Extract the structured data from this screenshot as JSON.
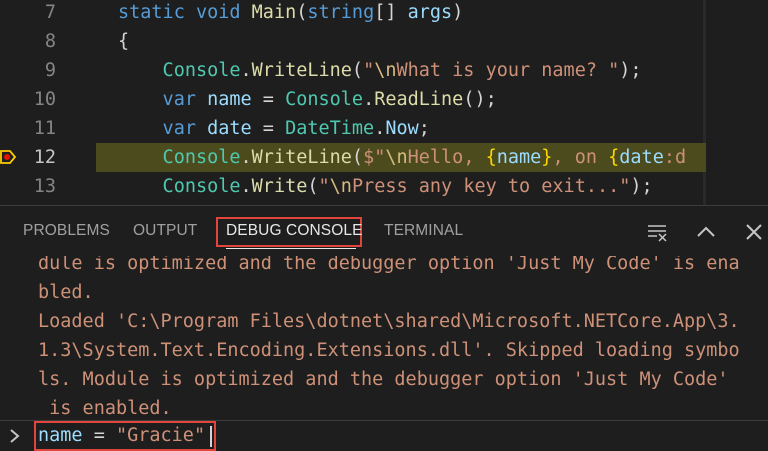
{
  "editor": {
    "lines": [
      {
        "num": "7",
        "tokens": [
          {
            "t": "static ",
            "c": "kw"
          },
          {
            "t": "void ",
            "c": "kw"
          },
          {
            "t": "Main",
            "c": "fn"
          },
          {
            "t": "(",
            "c": "punc"
          },
          {
            "t": "string",
            "c": "kw"
          },
          {
            "t": "[] ",
            "c": "punc"
          },
          {
            "t": "args",
            "c": "var"
          },
          {
            "t": ")",
            "c": "punc"
          }
        ]
      },
      {
        "num": "8",
        "tokens": [
          {
            "t": "{",
            "c": "punc"
          }
        ]
      },
      {
        "num": "9",
        "tokens": [
          {
            "t": "    Console",
            "c": "cls"
          },
          {
            "t": ".",
            "c": "punc"
          },
          {
            "t": "WriteLine",
            "c": "fn"
          },
          {
            "t": "(",
            "c": "punc"
          },
          {
            "t": "\"",
            "c": "str"
          },
          {
            "t": "\\n",
            "c": "esc"
          },
          {
            "t": "What is your name? \"",
            "c": "str"
          },
          {
            "t": ");",
            "c": "punc"
          }
        ]
      },
      {
        "num": "10",
        "tokens": [
          {
            "t": "    var ",
            "c": "kw"
          },
          {
            "t": "name",
            "c": "var"
          },
          {
            "t": " = ",
            "c": "punc"
          },
          {
            "t": "Console",
            "c": "cls"
          },
          {
            "t": ".",
            "c": "punc"
          },
          {
            "t": "ReadLine",
            "c": "fn"
          },
          {
            "t": "();",
            "c": "punc"
          }
        ]
      },
      {
        "num": "11",
        "tokens": [
          {
            "t": "    var ",
            "c": "kw"
          },
          {
            "t": "date",
            "c": "var"
          },
          {
            "t": " = ",
            "c": "punc"
          },
          {
            "t": "DateTime",
            "c": "cls"
          },
          {
            "t": ".",
            "c": "punc"
          },
          {
            "t": "Now",
            "c": "var"
          },
          {
            "t": ";",
            "c": "punc"
          }
        ]
      },
      {
        "num": "12",
        "highlighted": true,
        "tokens": [
          {
            "t": "    Console",
            "c": "cls"
          },
          {
            "t": ".",
            "c": "punc"
          },
          {
            "t": "WriteLine",
            "c": "fn"
          },
          {
            "t": "(",
            "c": "punc"
          },
          {
            "t": "$\"",
            "c": "str"
          },
          {
            "t": "\\n",
            "c": "esc"
          },
          {
            "t": "Hello, ",
            "c": "str"
          },
          {
            "t": "{",
            "c": "br"
          },
          {
            "t": "name",
            "c": "var"
          },
          {
            "t": "}",
            "c": "br"
          },
          {
            "t": ", on ",
            "c": "str"
          },
          {
            "t": "{",
            "c": "br"
          },
          {
            "t": "date",
            "c": "var"
          },
          {
            "t": ":d",
            "c": "str"
          }
        ]
      },
      {
        "num": "13",
        "tokens": [
          {
            "t": "    Console",
            "c": "cls"
          },
          {
            "t": ".",
            "c": "punc"
          },
          {
            "t": "Write",
            "c": "fn"
          },
          {
            "t": "(",
            "c": "punc"
          },
          {
            "t": "\"",
            "c": "str"
          },
          {
            "t": "\\n",
            "c": "esc"
          },
          {
            "t": "Press any key to exit...\"",
            "c": "str"
          },
          {
            "t": ");",
            "c": "punc"
          }
        ]
      }
    ]
  },
  "panel": {
    "tabs": {
      "problems": "PROBLEMS",
      "output": "OUTPUT",
      "debug_console": "DEBUG CONSOLE",
      "terminal": "TERMINAL"
    },
    "active_tab": "DEBUG CONSOLE",
    "icons": [
      "clear-console-icon",
      "chevron-up-icon",
      "close-icon"
    ],
    "console_lines": [
      "dule is optimized and the debugger option 'Just My Code' is ena",
      "bled.",
      "Loaded 'C:\\Program Files\\dotnet\\shared\\Microsoft.NETCore.App\\3.",
      "1.3\\System.Text.Encoding.Extensions.dll'. Skipped loading symbo",
      "ls. Module is optimized and the debugger option 'Just My Code'",
      " is enabled."
    ],
    "input": {
      "var": "name",
      "op": " = ",
      "value": "\"Gracie\""
    }
  },
  "colors": {
    "highlight_annotation": "#e0463b",
    "console_text": "#ce9178",
    "current_line": "#4b4b1e"
  }
}
